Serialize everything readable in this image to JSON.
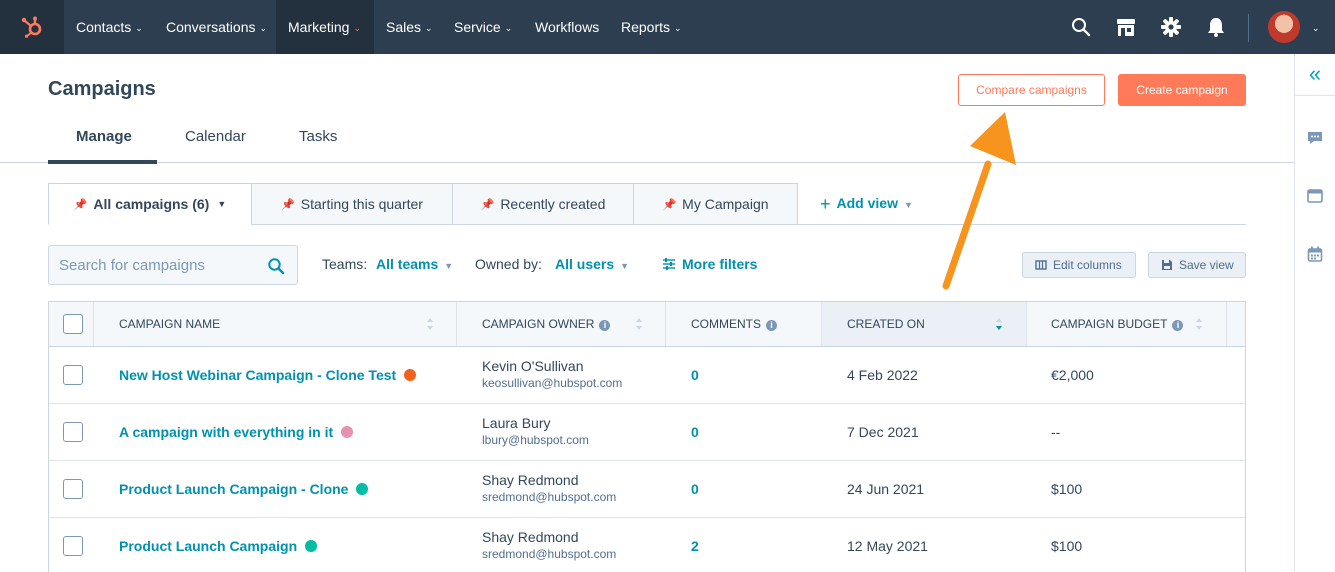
{
  "nav": {
    "items": [
      {
        "label": "Contacts"
      },
      {
        "label": "Conversations"
      },
      {
        "label": "Marketing"
      },
      {
        "label": "Sales"
      },
      {
        "label": "Service"
      },
      {
        "label": "Workflows"
      },
      {
        "label": "Reports"
      }
    ],
    "active": "Marketing",
    "icons": [
      "search-icon",
      "marketplace-icon",
      "settings-icon",
      "notifications-icon"
    ]
  },
  "header": {
    "title": "Campaigns",
    "compare_label": "Compare campaigns",
    "create_label": "Create campaign"
  },
  "tabs": [
    {
      "label": "Manage"
    },
    {
      "label": "Calendar"
    },
    {
      "label": "Tasks"
    }
  ],
  "views": [
    {
      "label": "All campaigns (6)"
    },
    {
      "label": "Starting this quarter"
    },
    {
      "label": "Recently created"
    },
    {
      "label": "My Campaign"
    }
  ],
  "add_view_label": "Add view",
  "filters": {
    "search_placeholder": "Search for campaigns",
    "teams_label": "Teams:",
    "teams_value": "All teams",
    "owner_label": "Owned by:",
    "owner_value": "All users",
    "more_filters_label": "More filters",
    "edit_columns_label": "Edit columns",
    "save_view_label": "Save view"
  },
  "table": {
    "columns": [
      "CAMPAIGN NAME",
      "CAMPAIGN OWNER",
      "COMMENTS",
      "CREATED ON",
      "CAMPAIGN BUDGET"
    ],
    "rows": [
      {
        "name": "New Host Webinar Campaign - Clone Test",
        "color": "#f2611d",
        "owner": "Kevin O'Sullivan",
        "email": "keosullivan@hubspot.com",
        "comments": "0",
        "created": "4 Feb 2022",
        "budget": "€2,000"
      },
      {
        "name": "A campaign with everything in it",
        "color": "#ea90b1",
        "owner": "Laura Bury",
        "email": "lbury@hubspot.com",
        "comments": "0",
        "created": "7 Dec 2021",
        "budget": "--"
      },
      {
        "name": "Product Launch Campaign - Clone",
        "color": "#00bda5",
        "owner": "Shay Redmond",
        "email": "sredmond@hubspot.com",
        "comments": "0",
        "created": "24 Jun 2021",
        "budget": "$100"
      },
      {
        "name": "Product Launch Campaign",
        "color": "#00bda5",
        "owner": "Shay Redmond",
        "email": "sredmond@hubspot.com",
        "comments": "2",
        "created": "12 May 2021",
        "budget": "$100"
      }
    ]
  },
  "colors": {
    "nav_bg": "#2d3e50",
    "accent": "#ff7a59",
    "link": "#0091ae",
    "annotation_arrow": "#f7941d"
  }
}
